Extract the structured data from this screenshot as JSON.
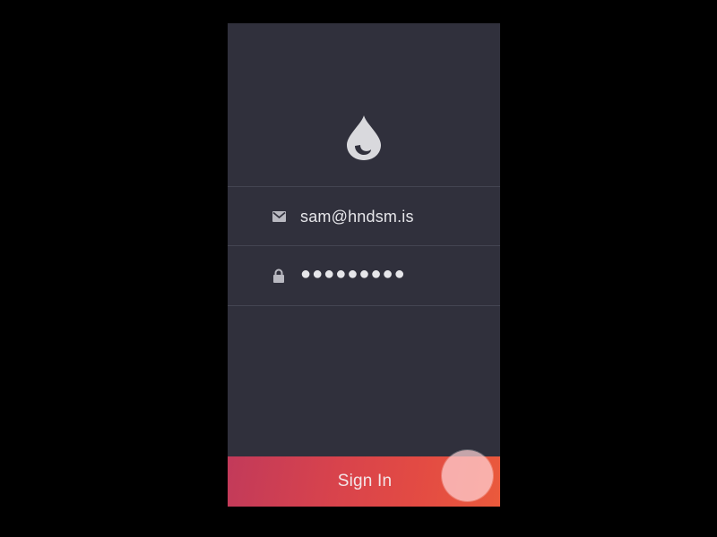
{
  "app": {
    "colors": {
      "background": "#30303c",
      "divider": "#444552",
      "text": "#e6e6ea",
      "icon": "#d6d6db",
      "button_gradient_start": "#c23a5a",
      "button_gradient_end": "#ea5a3c"
    }
  },
  "logo": {
    "icon": "water-drop-icon"
  },
  "form": {
    "email": {
      "icon": "envelope-icon",
      "value": "sam@hndsm.is"
    },
    "password": {
      "icon": "lock-icon",
      "value": "●●●●●●●●●"
    }
  },
  "signin": {
    "label": "Sign In"
  }
}
